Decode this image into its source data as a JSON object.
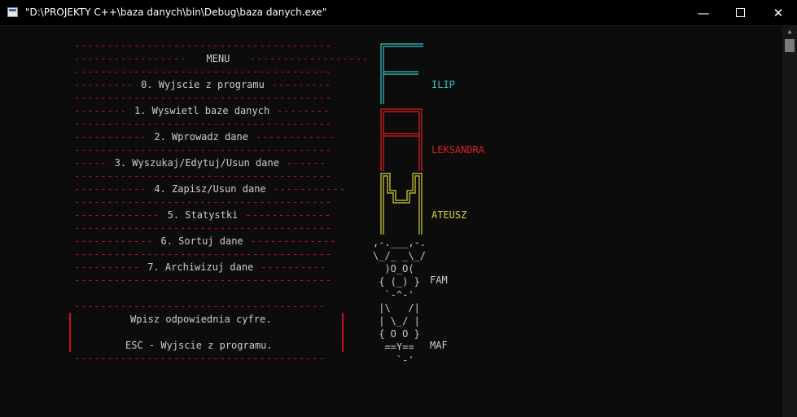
{
  "window": {
    "title": "\"D:\\PROJEKTY C++\\baza danych\\bin\\Debug\\baza danych.exe\"",
    "minimize_glyph": "—",
    "close_glyph": "✕"
  },
  "menu": {
    "header": "MENU",
    "items": [
      "0. Wyjscie z programu",
      "1. Wyswietl baze danych",
      "2. Wprowadz dane",
      "3. Wyszukaj/Edytuj/Usun dane",
      "4. Zapisz/Usun dane",
      "5. Statystki",
      "6. Sortuj dane",
      "7. Archiwizuj dane"
    ]
  },
  "prompt": {
    "line1": "Wpisz odpowiednia cyfre.",
    "line2": "ESC - Wyjscie z programu."
  },
  "initials": [
    {
      "letter": "F",
      "rest": "ILIP",
      "color": "#3ac1c6"
    },
    {
      "letter": "A",
      "rest": "LEKSANDRA",
      "color": "#e21d1d"
    },
    {
      "letter": "M",
      "rest": "ATEUSZ",
      "color": "#d8d23a"
    }
  ],
  "ascii": {
    "fam_art": [
      ",-.___,-.",
      "\\_/_ _\\_/",
      "  )O_O(",
      " { (_) }",
      "  `-^-'"
    ],
    "fam_label": "FAM",
    "maf_art": [
      " |\\   /|",
      " | \\_/ |",
      " { O O }",
      "  ==Y==",
      "    `-'"
    ],
    "maf_label": "MAF"
  },
  "colors": {
    "background": "#0c0c0c",
    "dash": "#c50f1f",
    "text": "#cccccc",
    "cyan": "#3ac1c6",
    "red": "#e21d1d",
    "yellow": "#d8d23a"
  }
}
